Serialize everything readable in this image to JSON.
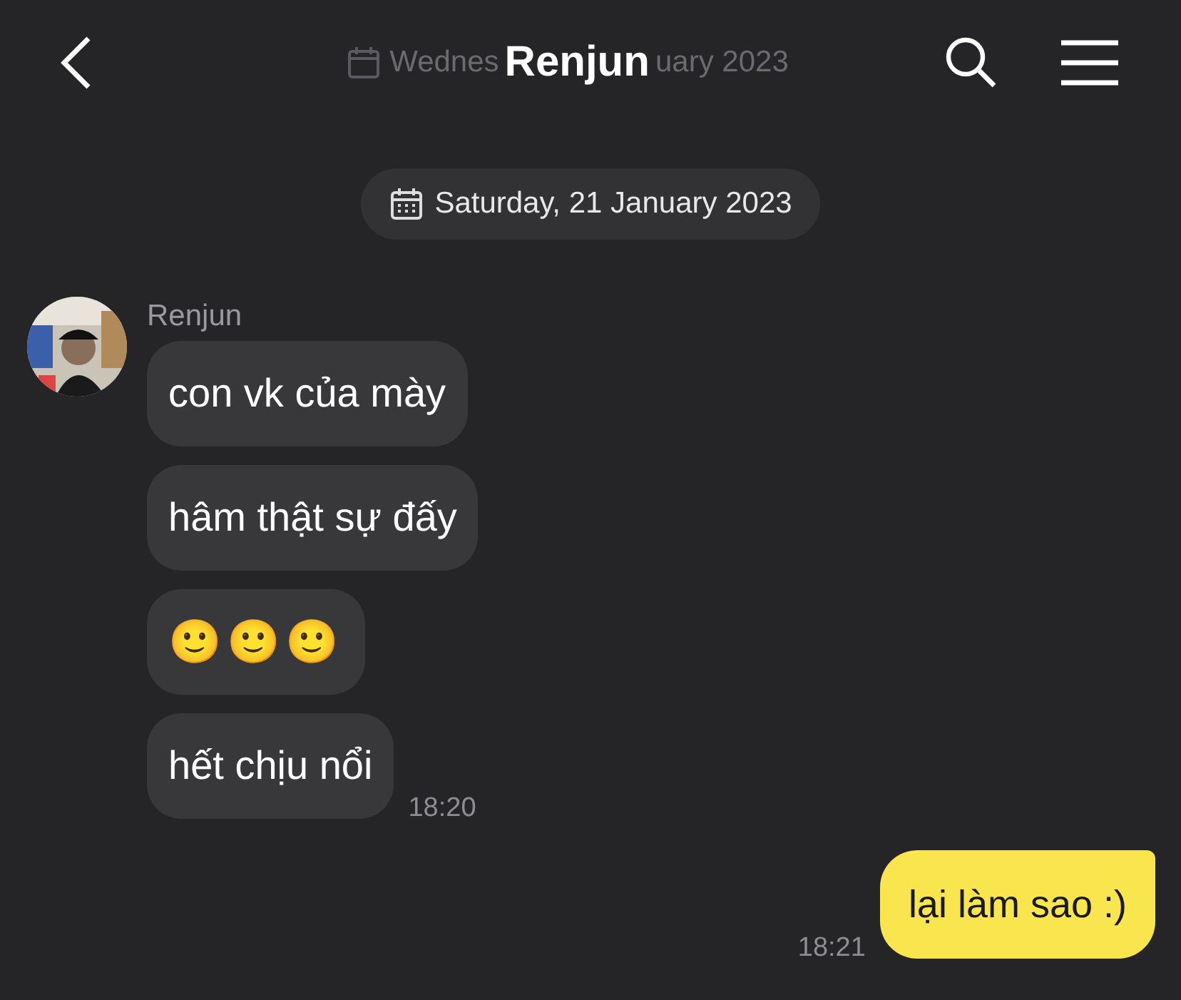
{
  "header": {
    "title": "Renjun",
    "faded_date_before": "Wednes",
    "faded_date_after": "uary 2023"
  },
  "date_pill": "Saturday, 21 January 2023",
  "incoming": {
    "sender": "Renjun",
    "time": "18:20",
    "messages": [
      {
        "text": "con vk của mày"
      },
      {
        "text": "hâm thật sự đấy"
      },
      {
        "text": "🙂🙂🙂",
        "kind": "emoji"
      },
      {
        "text": "hết chịu nổi"
      }
    ]
  },
  "outgoing": {
    "time": "18:21",
    "messages": [
      {
        "text": "lại làm sao :)"
      }
    ]
  }
}
